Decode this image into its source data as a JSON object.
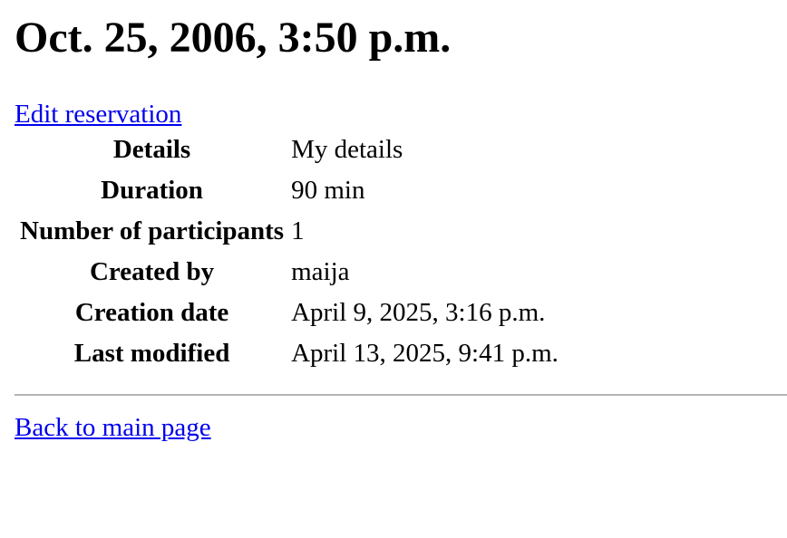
{
  "page": {
    "title": "Oct. 25, 2006, 3:50 p.m."
  },
  "links": {
    "edit": "Edit reservation",
    "back": "Back to main page"
  },
  "colors": {
    "link": "#0000ee",
    "divider": "#b5b5b5"
  },
  "details": {
    "rows": [
      {
        "label": "Details",
        "value": "My details"
      },
      {
        "label": "Duration",
        "value": "90 min"
      },
      {
        "label": "Number of participants",
        "value": "1"
      },
      {
        "label": "Created by",
        "value": "maija"
      },
      {
        "label": "Creation date",
        "value": "April 9, 2025, 3:16 p.m."
      },
      {
        "label": "Last modified",
        "value": "April 13, 2025, 9:41 p.m."
      }
    ]
  }
}
